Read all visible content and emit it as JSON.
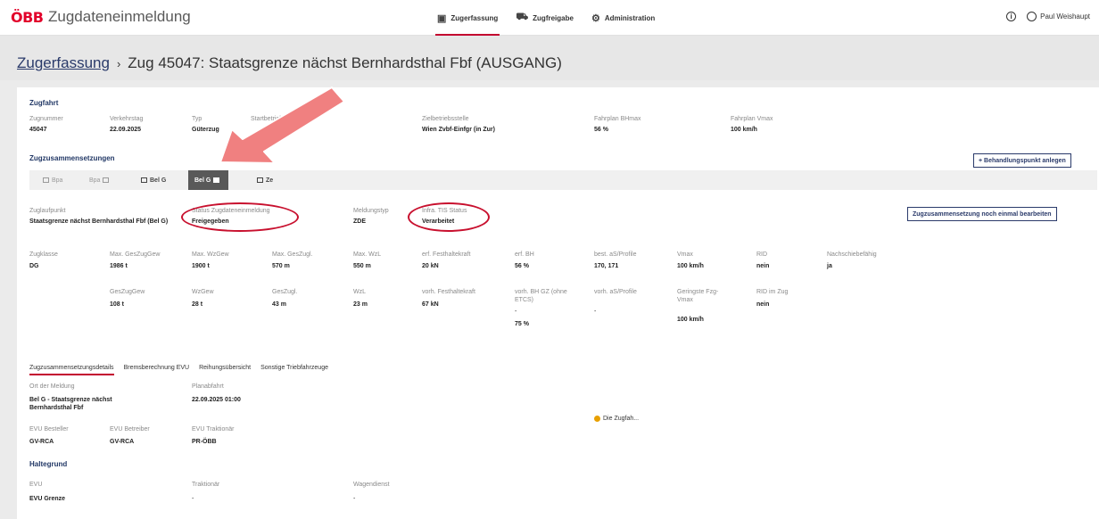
{
  "header": {
    "logo": "ÖBB",
    "app_title": "Zugdateneinmeldung",
    "nav": [
      {
        "label": "Zugerfassung",
        "active": true
      },
      {
        "label": "Zugfreigabe",
        "active": false
      },
      {
        "label": "Administration",
        "active": false
      }
    ],
    "info_symbol": "i",
    "user": "Paul Weishaupt"
  },
  "breadcrumb": {
    "root": "Zugerfassung",
    "separator": "›",
    "current": "Zug 45047: Staatsgrenze nächst Bernhardsthal Fbf (AUSGANG)"
  },
  "zugfahrt": {
    "title": "Zugfahrt",
    "zugnummer_label": "Zugnummer",
    "zugnummer": "45047",
    "verkehrstag_label": "Verkehrstag",
    "verkehrstag": "22.09.2025",
    "typ_label": "Typ",
    "typ": "Güterzug",
    "startbetriebsstelle_label": "Startbetriebsstelle",
    "zielbetriebsstelle_label": "Zielbetriebsstelle",
    "zielbetriebsstelle": "Wien Zvbf-Einfgr (in Zur)",
    "bhmax_label": "Fahrplan BHmax",
    "bhmax": "56 %",
    "vmax_label": "Fahrplan Vmax",
    "vmax": "100 km/h"
  },
  "zugzusammensetzungen": {
    "title": "Zugzusammensetzungen",
    "add_button": "+ Behandlungspunkt anlegen",
    "tabs": [
      {
        "label": "Bpa",
        "state": "disabled"
      },
      {
        "label": "Bpa",
        "state": "disabled"
      },
      {
        "label": "Bel G",
        "state": "normal"
      },
      {
        "label": "Bel G",
        "state": "selected"
      },
      {
        "label": "Ze",
        "state": "normal"
      }
    ],
    "edit_button": "Zugzusammensetzung noch einmal bearbeiten"
  },
  "status": {
    "zuglaufpunkt_label": "Zuglaufpunkt",
    "zuglaufpunkt": "Staatsgrenze nächst Bernhardsthal Fbf (Bel G)",
    "status_label": "Status Zugdateneinmeldung",
    "status": "Freigegeben",
    "meldungstyp_label": "Meldungstyp",
    "meldungstyp": "ZDE",
    "tis_label": "Infra. TIS Status",
    "tis": "Verarbeitet"
  },
  "metrics_row1": [
    {
      "label": "Zugklasse",
      "value": "DG"
    },
    {
      "label": "Max. GesZugGew",
      "value": "1986 t"
    },
    {
      "label": "Max. WzGew",
      "value": "1900 t"
    },
    {
      "label": "Max. GesZugl.",
      "value": "570 m"
    },
    {
      "label": "Max. WzL",
      "value": "550 m"
    },
    {
      "label": "erf. Festhaltekraft",
      "value": "20 kN"
    },
    {
      "label": "erf. BH",
      "value": "56 %"
    },
    {
      "label": "best. aS/Profile",
      "value": "170, 171"
    },
    {
      "label": "Vmax",
      "value": "100 km/h"
    },
    {
      "label": "RID",
      "value": "nein"
    },
    {
      "label": "Nachschiebefähig",
      "value": "ja"
    }
  ],
  "metrics_row2": [
    {
      "label": "GesZugGew",
      "value": "108 t"
    },
    {
      "label": "WzGew",
      "value": "28 t"
    },
    {
      "label": "GesZugl.",
      "value": "43 m"
    },
    {
      "label": "WzL",
      "value": "23 m"
    },
    {
      "label": "vorh. Festhaltekraft",
      "value": "67 kN"
    },
    {
      "label": "vorh. BH GZ (ohne ETCS)",
      "value": "-",
      "value2": "75 %"
    },
    {
      "label": "vorh. aS/Profile",
      "value": "-",
      "hint": "Die Zugfah..."
    },
    {
      "label": "Geringste Fzg-Vmax",
      "value": "100 km/h"
    },
    {
      "label": "RID im Zug",
      "value": "nein"
    }
  ],
  "detail_tabs": [
    {
      "label": "Zugzusammensetzungsdetails",
      "active": true
    },
    {
      "label": "Bremsberechnung EVU",
      "active": false
    },
    {
      "label": "Reihungsübersicht",
      "active": false
    },
    {
      "label": "Sonstige Triebfahrzeuge",
      "active": false
    }
  ],
  "details": {
    "ort_label": "Ort der Meldung",
    "ort": "Bel G - Staatsgrenze nächst Bernhardsthal Fbf",
    "planabfahrt_label": "Planabfahrt",
    "planabfahrt": "22.09.2025 01:00",
    "besteller_label": "EVU Besteller",
    "besteller": "GV-RCA",
    "betreiber_label": "EVU Betreiber",
    "betreiber": "GV-RCA",
    "traktionaer_label": "EVU Traktionär",
    "traktionaer": "PR-ÖBB"
  },
  "haltegrund": {
    "title": "Haltegrund",
    "evu_label": "EVU",
    "evu": "EVU Grenze",
    "traktionaer_label": "Traktionär",
    "traktionaer": "-",
    "wagendienst_label": "Wagendienst",
    "wagendienst": "-"
  },
  "annotation_color": "#c8102e",
  "arrow_color": "#f08080"
}
